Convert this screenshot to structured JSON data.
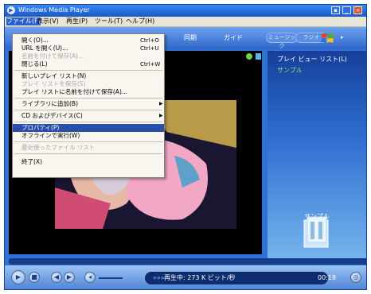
{
  "window": {
    "title": "Windows Media Player"
  },
  "menubar": [
    "ファイル(F)",
    "表示(V)",
    "再生(P)",
    "ツール(T)",
    "ヘルプ(H)"
  ],
  "nav": {
    "sync": "同期",
    "guide": "ガイド",
    "music": "ミュージック",
    "radio": "ラジオ"
  },
  "file_menu": [
    {
      "label": "開く(O)...",
      "shortcut": "Ctrl+O",
      "disabled": false,
      "selected": false,
      "submenu": false
    },
    {
      "label": "URL を開く(U)...",
      "shortcut": "Ctrl+U",
      "disabled": false,
      "selected": false,
      "submenu": false
    },
    {
      "label": "名前を付けて保存(A)...",
      "shortcut": "",
      "disabled": true,
      "selected": false,
      "submenu": false
    },
    {
      "label": "閉じる(L)",
      "shortcut": "Ctrl+W",
      "disabled": false,
      "selected": false,
      "submenu": false
    },
    {
      "label": "新しいプレイ リスト(N)",
      "shortcut": "",
      "disabled": false,
      "selected": false,
      "submenu": false
    },
    {
      "label": "プレイ リストを保存(S)",
      "shortcut": "",
      "disabled": true,
      "selected": false,
      "submenu": false
    },
    {
      "label": "プレイ リストに名前を付けて保存(A)...",
      "shortcut": "",
      "disabled": false,
      "selected": false,
      "submenu": false
    },
    {
      "label": "ライブラリに追加(B)",
      "shortcut": "",
      "disabled": false,
      "selected": false,
      "submenu": true
    },
    {
      "label": "CD およびデバイス(C)",
      "shortcut": "",
      "disabled": false,
      "selected": false,
      "submenu": true
    },
    {
      "label": "プロパティ(P)",
      "shortcut": "",
      "disabled": false,
      "selected": true,
      "submenu": false
    },
    {
      "label": "オフラインで実行(W)",
      "shortcut": "",
      "disabled": false,
      "selected": false,
      "submenu": false
    },
    {
      "label": "最近使ったファイル リスト",
      "shortcut": "",
      "disabled": true,
      "selected": false,
      "submenu": false
    },
    {
      "label": "終了(X)",
      "shortcut": "",
      "disabled": false,
      "selected": false,
      "submenu": false
    }
  ],
  "playlist": {
    "title": "プレイ ビュー リスト(L)",
    "item": "サンプル",
    "caption": "サンプル"
  },
  "status": {
    "text": "再生中: 273 K ビット/秒",
    "time": "00:18"
  },
  "colors": {
    "accent": "#2f73d6",
    "menu_highlight": "#294fa8",
    "playlist_item": "#7cf07a"
  }
}
